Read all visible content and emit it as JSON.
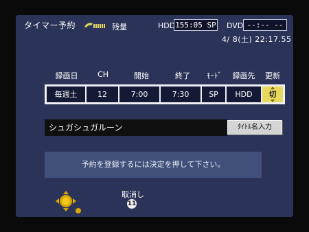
{
  "header": {
    "title": "タイマー予約",
    "remain_label": "残量",
    "hdd_label": "HDD",
    "hdd_value": "155:05 SP",
    "dvd_label": "DVD",
    "dvd_value": "--:-- --",
    "datetime": "4/ 8(土) 22:17.55"
  },
  "table": {
    "headers": [
      "録画日",
      "CH",
      "開始",
      "終了",
      "ﾓｰﾄﾞ",
      "録画先",
      "更新"
    ],
    "row": [
      "毎週土",
      "12",
      "7:00",
      "7:30",
      "SP",
      "HDD",
      "切"
    ]
  },
  "title_field": {
    "value": "シュガシュガルーン",
    "button_label": "ﾀｲﾄﾙ名入力"
  },
  "message": "予約を登録するには決定を押して下さい。",
  "footer": {
    "cancel_label": "取消し",
    "cancel_key": "11"
  }
}
